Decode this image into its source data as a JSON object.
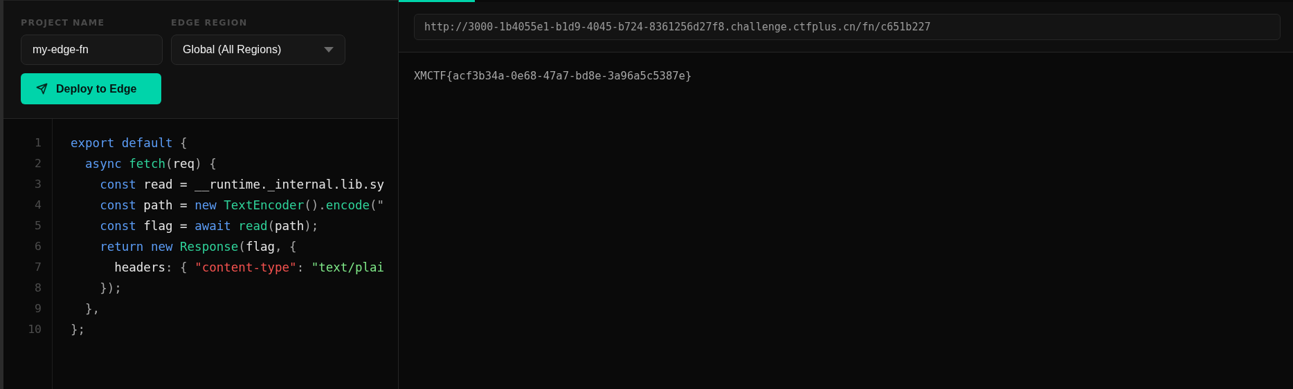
{
  "form": {
    "project_label": "PROJECT NAME",
    "project_value": "my-edge-fn",
    "region_label": "EDGE REGION",
    "region_value": "Global (All Regions)",
    "deploy_button": "Deploy to Edge"
  },
  "editor": {
    "lines": [
      {
        "number": "1",
        "tokens": [
          {
            "kind": "kw",
            "text": "export default "
          },
          {
            "kind": "punct",
            "text": "{"
          }
        ]
      },
      {
        "number": "2",
        "tokens": [
          {
            "kind": "kw",
            "text": "  async "
          },
          {
            "kind": "fn",
            "text": "fetch"
          },
          {
            "kind": "punct",
            "text": "("
          },
          {
            "kind": "plain",
            "text": "req"
          },
          {
            "kind": "punct",
            "text": ") {"
          }
        ]
      },
      {
        "number": "3",
        "tokens": [
          {
            "kind": "kw",
            "text": "    const "
          },
          {
            "kind": "plain",
            "text": "read = __runtime._internal.lib.sy"
          }
        ]
      },
      {
        "number": "4",
        "tokens": [
          {
            "kind": "kw",
            "text": "    const "
          },
          {
            "kind": "plain",
            "text": "path = "
          },
          {
            "kind": "kw",
            "text": "new "
          },
          {
            "kind": "fn",
            "text": "TextEncoder"
          },
          {
            "kind": "punct",
            "text": "()."
          },
          {
            "kind": "fn",
            "text": "encode"
          },
          {
            "kind": "punct",
            "text": "(\""
          }
        ]
      },
      {
        "number": "5",
        "tokens": [
          {
            "kind": "kw",
            "text": "    const "
          },
          {
            "kind": "plain",
            "text": "flag = "
          },
          {
            "kind": "kw",
            "text": "await "
          },
          {
            "kind": "fn",
            "text": "read"
          },
          {
            "kind": "punct",
            "text": "("
          },
          {
            "kind": "plain",
            "text": "path"
          },
          {
            "kind": "punct",
            "text": ");"
          }
        ]
      },
      {
        "number": "6",
        "tokens": [
          {
            "kind": "kw",
            "text": "    return new "
          },
          {
            "kind": "fn",
            "text": "Response"
          },
          {
            "kind": "punct",
            "text": "("
          },
          {
            "kind": "plain",
            "text": "flag"
          },
          {
            "kind": "punct",
            "text": ", {"
          }
        ]
      },
      {
        "number": "7",
        "tokens": [
          {
            "kind": "plain",
            "text": "      headers"
          },
          {
            "kind": "punct",
            "text": ": { "
          },
          {
            "kind": "str",
            "text": "\"content-type\""
          },
          {
            "kind": "punct",
            "text": ": "
          },
          {
            "kind": "str2",
            "text": "\"text/plai"
          }
        ]
      },
      {
        "number": "8",
        "tokens": [
          {
            "kind": "punct",
            "text": "    });"
          }
        ]
      },
      {
        "number": "9",
        "tokens": [
          {
            "kind": "punct",
            "text": "  },"
          }
        ]
      },
      {
        "number": "10",
        "tokens": [
          {
            "kind": "punct",
            "text": "};"
          }
        ]
      }
    ]
  },
  "preview": {
    "progress": {
      "level": 0.085
    },
    "url": "http://3000-1b4055e1-b1d9-4045-b724-8361256d27f8.challenge.ctfplus.cn/fn/c651b227",
    "output": "XMCTF{acf3b34a-0e68-47a7-bd8e-3a96a5c5387e}"
  }
}
